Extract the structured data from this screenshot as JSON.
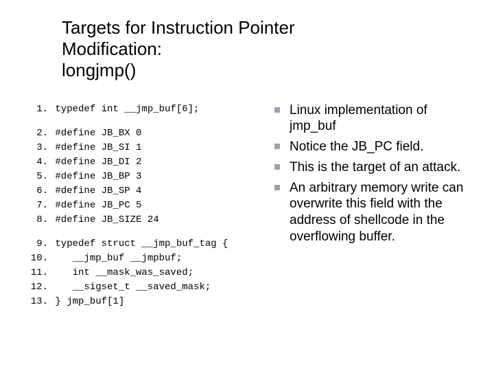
{
  "title_line1": "Targets for Instruction Pointer",
  "title_line2": "Modification:",
  "title_line3": "longjmp()",
  "code": {
    "lines": [
      {
        "n": "1.",
        "t": "typedef int __jmp_buf[6];"
      },
      {
        "n": "",
        "t": ""
      },
      {
        "n": "2.",
        "t": "#define JB_BX 0"
      },
      {
        "n": "3.",
        "t": "#define JB_SI 1"
      },
      {
        "n": "4.",
        "t": "#define JB_DI 2"
      },
      {
        "n": "5.",
        "t": "#define JB_BP 3"
      },
      {
        "n": "6.",
        "t": "#define JB_SP 4"
      },
      {
        "n": "7.",
        "t": "#define JB_PC 5"
      },
      {
        "n": "8.",
        "t": "#define JB_SIZE 24"
      },
      {
        "n": "",
        "t": ""
      },
      {
        "n": "9.",
        "t": "typedef struct __jmp_buf_tag {"
      },
      {
        "n": "10.",
        "t": "   __jmp_buf __jmpbuf;"
      },
      {
        "n": "11.",
        "t": "   int __mask_was_saved;"
      },
      {
        "n": "12.",
        "t": "   __sigset_t __saved_mask;"
      },
      {
        "n": "13.",
        "t": "} jmp_buf[1]"
      }
    ]
  },
  "bullets": [
    "Linux implementation of jmp_buf",
    "Notice the JB_PC field.",
    "This is the target of an attack.",
    "An arbitrary memory write can overwrite this field with the address of shellcode in the overflowing buffer."
  ]
}
